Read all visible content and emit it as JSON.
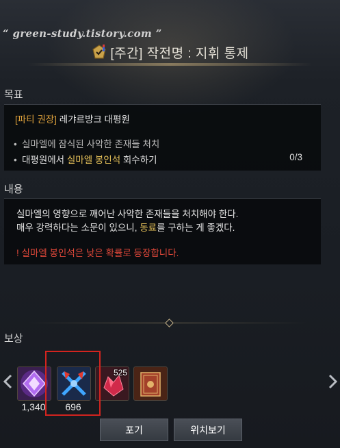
{
  "watermark": "green-study.tistory.com",
  "title": "[주간] 작전명 : 지휘 통제",
  "objective": {
    "label": "목표",
    "tag": "[파티 권장]",
    "location": "레갸르방크 대평원",
    "rows": [
      {
        "bullet": "•",
        "text": "실마엘에 잠식된 사악한 존재들 처치"
      },
      {
        "bullet": "•",
        "pre": "대평원에서 ",
        "highlight": "실마엘 봉인석",
        "post": " 회수하기",
        "count": "0/3"
      }
    ]
  },
  "content": {
    "label": "내용",
    "line1": "실마엘의 영향으로 깨어난 사악한 존재들을 처치해야 한다.",
    "line2_pre": "매우 강력하다는 소문이 있으니, ",
    "line2_highlight": "동료",
    "line2_post": "를 구하는 게 좋겠다.",
    "warning": "! 실마엘 봉인석은 낮은 확률로 등장합니다."
  },
  "reward": {
    "label": "보상",
    "items": [
      {
        "icon": "purple-crystal-icon",
        "count": "1,340"
      },
      {
        "icon": "crossed-axes-icon",
        "count": "696"
      },
      {
        "icon": "red-gem-icon",
        "stack": "525"
      },
      {
        "icon": "red-book-icon"
      }
    ]
  },
  "buttons": {
    "abandon": "포기",
    "location": "위치보기"
  },
  "colors": {
    "tag": "#e0a33c",
    "highlight": "#e8c35a",
    "warning": "#e0483a",
    "annotation": "#d3241f"
  }
}
